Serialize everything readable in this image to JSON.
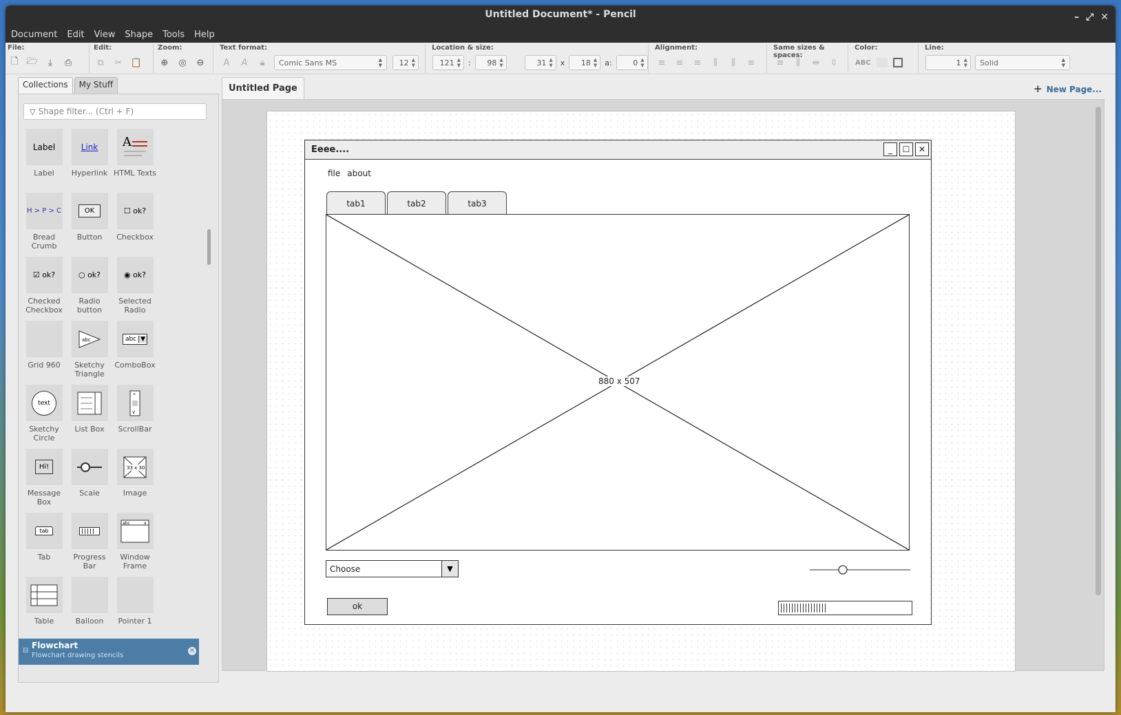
{
  "window": {
    "title": "Untitled Document* - Pencil",
    "controls": [
      "–",
      "⤢",
      "✕"
    ]
  },
  "menubar": [
    "Document",
    "Edit",
    "View",
    "Shape",
    "Tools",
    "Help"
  ],
  "toolbar": {
    "file_label": "File:",
    "edit_label": "Edit:",
    "zoom_label": "Zoom:",
    "text_format_label": "Text format:",
    "font_name": "Comic Sans MS",
    "font_size": "12",
    "location_label": "Location & size:",
    "loc_x": "121",
    "loc_sep": ":",
    "loc_y": "98",
    "width": "31",
    "size_sep": "x",
    "height": "18",
    "angle_label": "a:",
    "angle": "0",
    "alignment_label": "Alignment:",
    "same_sizes_label": "Same sizes & spaces:",
    "color_label": "Color:",
    "color_text": "ABC",
    "line_label": "Line:",
    "line_width": "1",
    "line_style": "Solid"
  },
  "left_panel": {
    "tabs": [
      "Collections",
      "My Stuff"
    ],
    "filter_placeholder": "Shape filter... (Ctrl + F)",
    "shapes": [
      {
        "label": "Label",
        "icon": "label-shape"
      },
      {
        "label": "Hyperlink",
        "icon": "link-shape"
      },
      {
        "label": "HTML Texts",
        "icon": "html-text-shape"
      },
      {
        "label": "Bread Crumb",
        "icon": "breadcrumb-shape"
      },
      {
        "label": "Button",
        "icon": "button-shape"
      },
      {
        "label": "Checkbox",
        "icon": "checkbox-shape"
      },
      {
        "label": "Checked Checkbox",
        "icon": "checked-checkbox-shape"
      },
      {
        "label": "Radio button",
        "icon": "radio-shape"
      },
      {
        "label": "Selected Radio",
        "icon": "selected-radio-shape"
      },
      {
        "label": "Grid 960",
        "icon": "grid-shape"
      },
      {
        "label": "Sketchy Triangle",
        "icon": "triangle-shape"
      },
      {
        "label": "ComboBox",
        "icon": "combobox-shape"
      },
      {
        "label": "Sketchy Circle",
        "icon": "circle-shape"
      },
      {
        "label": "List Box",
        "icon": "listbox-shape"
      },
      {
        "label": "ScrollBar",
        "icon": "scrollbar-shape"
      },
      {
        "label": "Message Box",
        "icon": "messagebox-shape"
      },
      {
        "label": "Scale",
        "icon": "scale-shape"
      },
      {
        "label": "Image",
        "icon": "image-shape"
      },
      {
        "label": "Tab",
        "icon": "tab-shape"
      },
      {
        "label": "Progress Bar",
        "icon": "progressbar-shape"
      },
      {
        "label": "Window Frame",
        "icon": "windowframe-shape"
      },
      {
        "label": "Table",
        "icon": "table-shape"
      },
      {
        "label": "Balloon",
        "icon": "balloon-shape"
      },
      {
        "label": "Pointer 1",
        "icon": "pointer-shape"
      }
    ],
    "thumb_text": {
      "label": "Label",
      "link": "Link",
      "breadcrumb": "H > P > C",
      "ok_button": "OK",
      "ok_q": "ok?",
      "abc": "abc",
      "text": "text",
      "hi": "Hi!",
      "img_dims": "33 x 30",
      "tab": "tab"
    },
    "collection": {
      "title": "Flowchart",
      "subtitle": "Flowchart drawing stencils"
    }
  },
  "page_tab": "Untitled Page",
  "new_page": "New Page...",
  "mockup": {
    "title": "Eeee....",
    "menu": [
      "file",
      "about"
    ],
    "tabs": [
      "tab1",
      "tab2",
      "tab3"
    ],
    "image_dims": "880 x 507",
    "combo_value": "Choose",
    "button_label": "ok",
    "progress": 0.35,
    "slider_value": 0.33
  }
}
